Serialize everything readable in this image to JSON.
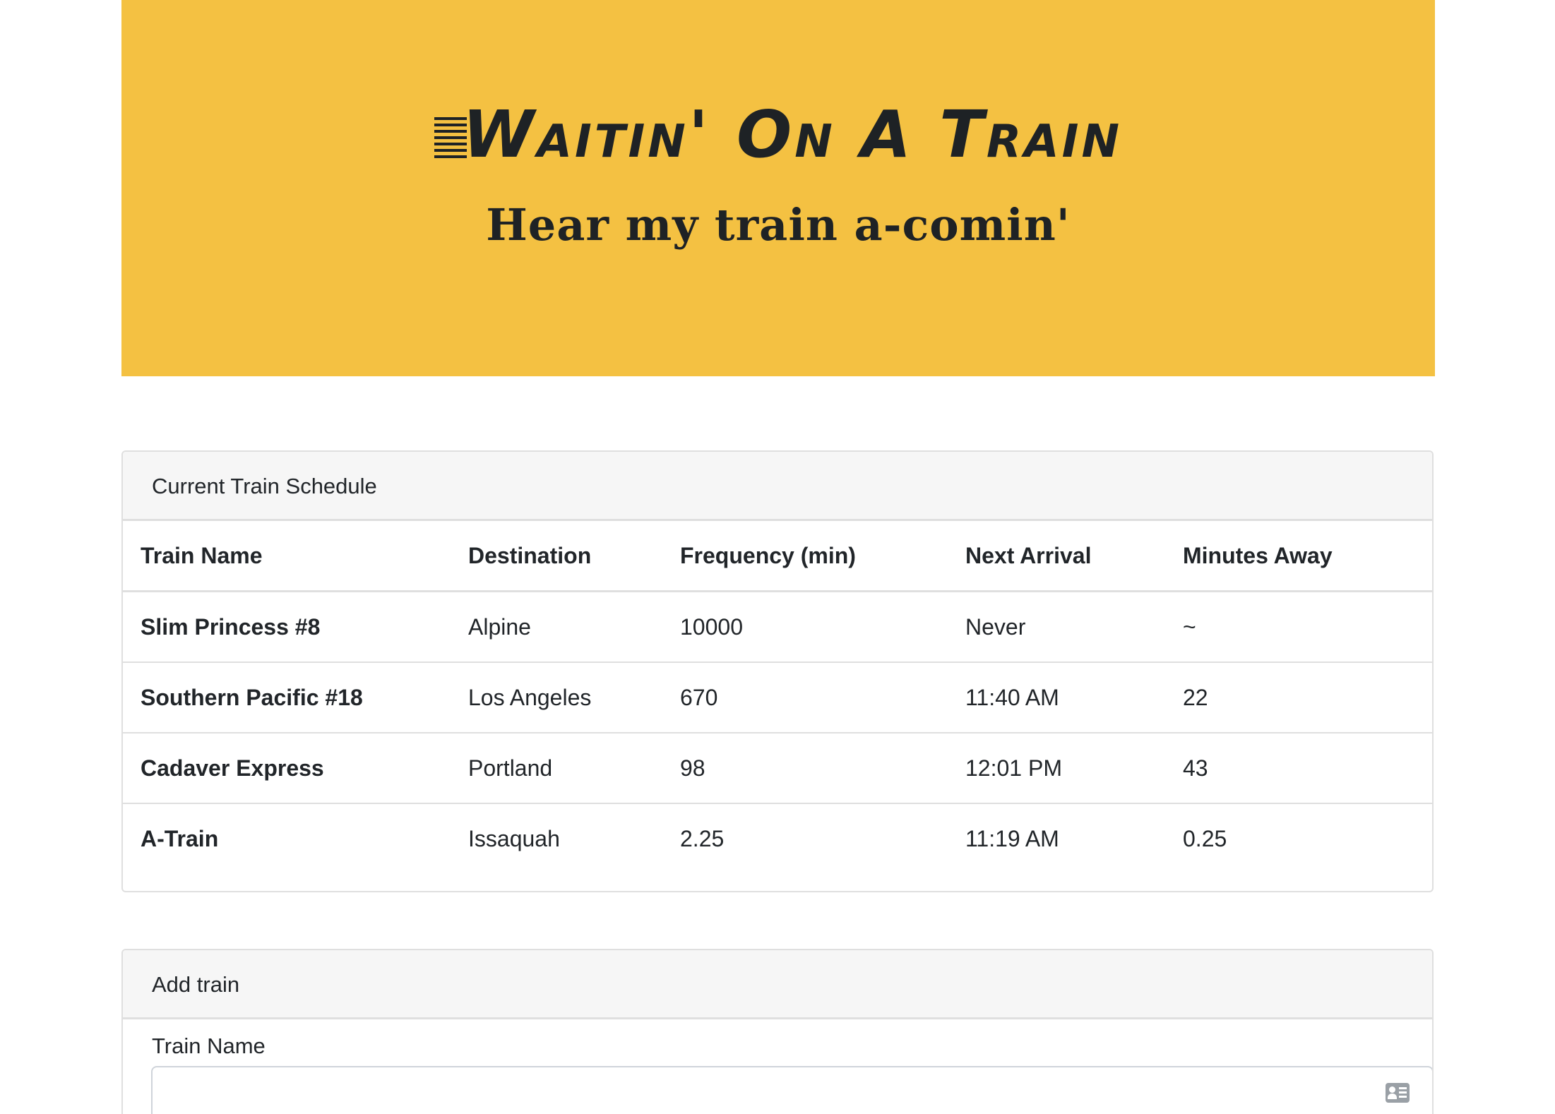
{
  "header": {
    "title": "Waitin' On A Train",
    "subtitle": "Hear my train a-comin'"
  },
  "schedule": {
    "heading": "Current Train Schedule",
    "columns": [
      "Train Name",
      "Destination",
      "Frequency (min)",
      "Next Arrival",
      "Minutes Away"
    ],
    "rows": [
      [
        "Slim Princess #8",
        "Alpine",
        "10000",
        "Never",
        "~"
      ],
      [
        "Southern Pacific #18",
        "Los Angeles",
        "670",
        "11:40 AM",
        "22"
      ],
      [
        "Cadaver Express",
        "Portland",
        "98",
        "12:01 PM",
        "43"
      ],
      [
        "A-Train",
        "Issaquah",
        "2.25",
        "11:19 AM",
        "0.25"
      ]
    ]
  },
  "add_train": {
    "heading": "Add train",
    "train_name_label": "Train Name",
    "train_name_value": "",
    "train_name_icon": "contact-card-icon"
  },
  "colors": {
    "jumbotron_bg": "#f4c142",
    "card_header_bg": "#f6f6f6",
    "text": "#212529"
  }
}
